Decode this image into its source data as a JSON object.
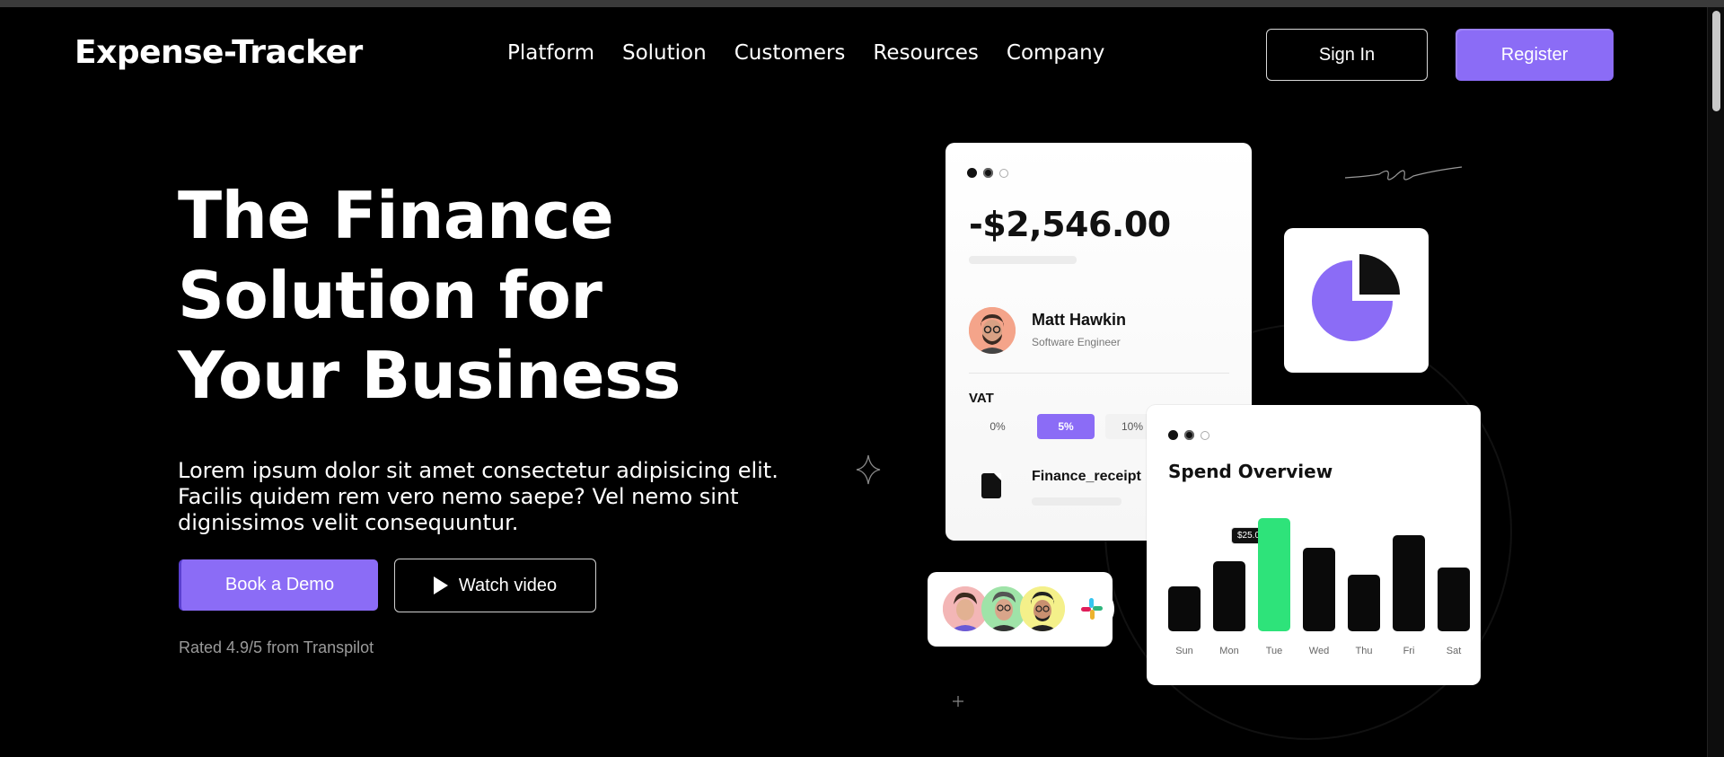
{
  "brand": {
    "name": "Expense-Tracker",
    "accent": "#8b6cf6",
    "success": "#2ee37a"
  },
  "nav": {
    "items": [
      "Platform",
      "Solution",
      "Customers",
      "Resources",
      "Company"
    ],
    "sign_in": "Sign In",
    "register": "Register"
  },
  "hero": {
    "title_lines": [
      "The Finance",
      "Solution for",
      "Your Business"
    ],
    "description": "Lorem ipsum dolor sit amet consectetur adipisicing elit. Facilis quidem rem vero nemo saepe? Vel nemo sint dignissimos velit consequuntur.",
    "cta_primary": "Book a Demo",
    "cta_secondary": "Watch video",
    "rating": "Rated 4.9/5 from Transpilot"
  },
  "transaction_card": {
    "amount": "-$2,546.00",
    "person_name": "Matt Hawkin",
    "person_role": "Software Engineer",
    "vat_label": "VAT",
    "vat_options": [
      "0%",
      "5%",
      "10%"
    ],
    "vat_selected": "5%",
    "file_name": "Finance_receipt"
  },
  "spend_card": {
    "title": "Spend Overview",
    "tooltip": "$25.000",
    "days": [
      "Sun",
      "Mon",
      "Tue",
      "Wed",
      "Thu",
      "Fri",
      "Sat"
    ],
    "values": [
      40,
      62,
      100,
      74,
      50,
      85,
      56
    ],
    "highlight_index": 2
  },
  "icons": [
    "play-icon",
    "pie-chart-icon",
    "file-icon",
    "slack-icon",
    "sparkle-icon"
  ]
}
